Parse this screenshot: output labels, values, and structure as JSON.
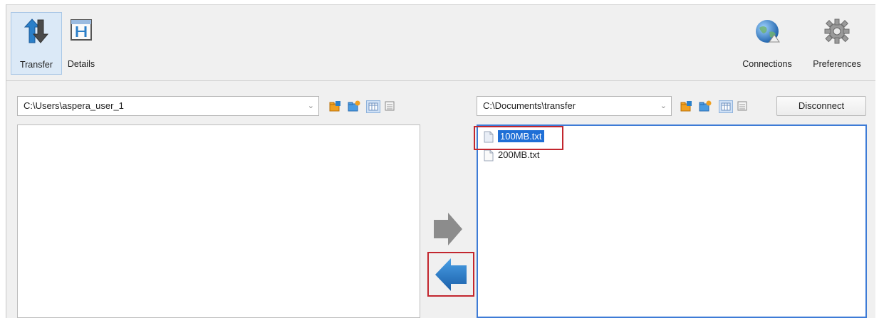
{
  "toolbar": {
    "transfer_label": "Transfer",
    "details_label": "Details",
    "connections_label": "Connections",
    "preferences_label": "Preferences"
  },
  "local_pane": {
    "path": "C:\\Users\\aspera_user_1",
    "files": []
  },
  "remote_pane": {
    "path": "C:\\Documents\\transfer",
    "disconnect_label": "Disconnect",
    "files": [
      {
        "name": "100MB.txt",
        "selected": true
      },
      {
        "name": "200MB.txt",
        "selected": false
      }
    ]
  },
  "transfer_arrows": {
    "upload": "upload-arrow",
    "download": "download-arrow"
  },
  "colors": {
    "selection": "#1f6fd6",
    "highlight_box": "#c2262e",
    "active_border": "#3d7bd6",
    "arrow_blue": "#2b7fc8",
    "arrow_gray": "#8c8c8c"
  }
}
